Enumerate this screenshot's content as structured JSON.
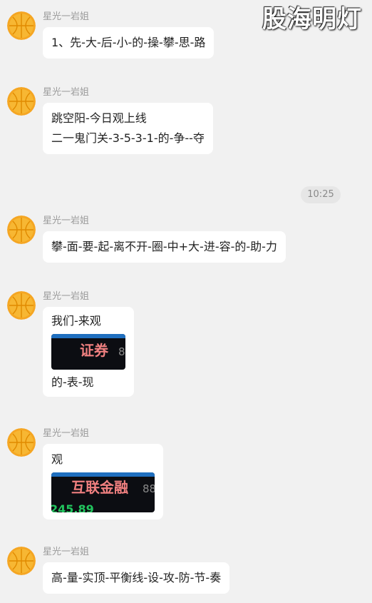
{
  "watermark": "股海明灯",
  "time_divider": "10:25",
  "messages": [
    {
      "sender": "星光一岩姐",
      "text": "1、先-大-后-小-的-操-攀-思-路"
    },
    {
      "sender": "星光一岩姐",
      "line1": "跳空阳-今日观上线",
      "line2": "二一鬼门关-3-5-3-1-的-争--夺"
    },
    {
      "sender": "星光一岩姐",
      "text": "攀-面-要-起-离不开-圈-中+大-进-容-的-助-力"
    },
    {
      "sender": "星光一岩姐",
      "line1": "我们-来观",
      "thumb_title": "证券",
      "thumb_num": "8",
      "line2": "的-表-现"
    },
    {
      "sender": "星光一岩姐",
      "line1": "观",
      "thumb_title": "互联金融",
      "thumb_num": "88",
      "thumb_green": "245.89"
    },
    {
      "sender": "星光一岩姐",
      "text": "高-量-实顶-平衡线-设-攻-防-节-奏"
    }
  ],
  "colors": {
    "background": "#f1f1f1",
    "bubble": "#ffffff",
    "sender_text": "#9b9b9b",
    "thumb_title": "#f08080",
    "thumb_green": "#22c55e",
    "thumb_bar": "#1f6fbf"
  },
  "icons": {
    "avatar": "orange-basketball-avatar"
  }
}
